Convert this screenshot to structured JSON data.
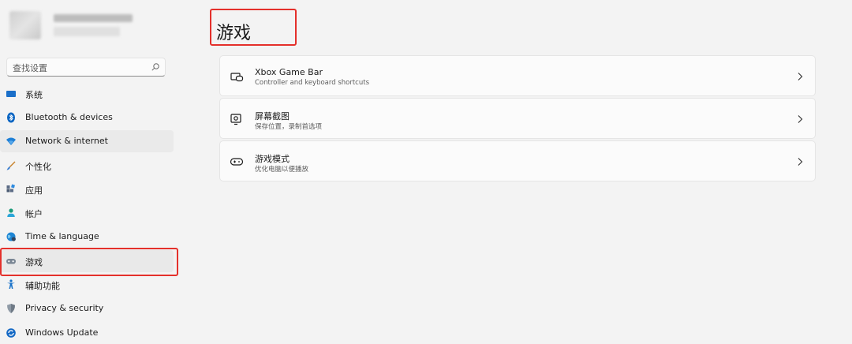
{
  "search": {
    "placeholder": "查找设置"
  },
  "sidebar": {
    "items": [
      {
        "label": "系统",
        "icon": "monitor-icon"
      },
      {
        "label": "Bluetooth & devices",
        "icon": "bluetooth-icon"
      },
      {
        "label": "Network & internet",
        "icon": "wifi-icon"
      },
      {
        "label": "个性化",
        "icon": "brush-icon"
      },
      {
        "label": "应用",
        "icon": "apps-icon"
      },
      {
        "label": "帐户",
        "icon": "person-icon"
      },
      {
        "label": "Time & language",
        "icon": "globe-clock-icon"
      },
      {
        "label": "游戏",
        "icon": "gamepad-icon"
      },
      {
        "label": "辅助功能",
        "icon": "accessibility-icon"
      },
      {
        "label": "Privacy & security",
        "icon": "shield-icon"
      },
      {
        "label": "Windows Update",
        "icon": "update-icon"
      }
    ],
    "selected_index": 7
  },
  "main": {
    "title": "游戏",
    "cards": [
      {
        "title": "Xbox Game Bar",
        "subtitle": "Controller and keyboard shortcuts",
        "icon": "game-bar-icon"
      },
      {
        "title": "屏幕截图",
        "subtitle": "保存位置，录制首选项",
        "icon": "capture-icon"
      },
      {
        "title": "游戏模式",
        "subtitle": "优化电脑以便播放",
        "icon": "game-mode-icon"
      }
    ]
  },
  "colors": {
    "background": "#f3f3f3",
    "card": "#fbfbfb",
    "highlight": "#e4302b",
    "accent": "#0067c0"
  }
}
